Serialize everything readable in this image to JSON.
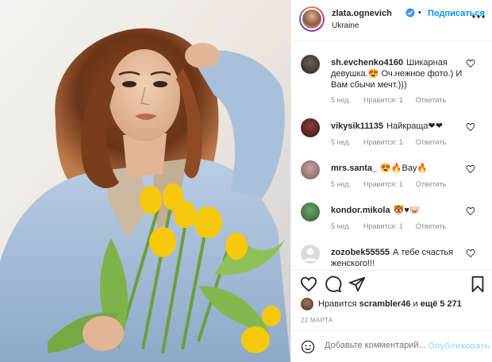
{
  "post": {
    "username": "zlata.ognevich",
    "separator": "•",
    "follow_label": "Подписаться",
    "location": "Ukraine",
    "accent": "#0095f6"
  },
  "comments": [
    {
      "user": "sh.evchenko4160",
      "text": "Шикарная девушка.😍 Оч.нежное фото.) И Вам сбычи мечт.)))",
      "time": "5 нед.",
      "likes": "Нравится: 1",
      "reply": "Ответить",
      "avatar_color": "#3a3530"
    },
    {
      "user": "vikysik11135",
      "text": "Найкраща❤❤",
      "time": "5 нед.",
      "likes": "Нравится: 1",
      "reply": "Ответить",
      "avatar_color": "#5a2a2a"
    },
    {
      "user": "mrs.santa_",
      "text": "😍🔥Вау🔥",
      "time": "5 нед.",
      "likes": "Нравится: 1",
      "reply": "Ответить",
      "avatar_color": "#b08a8a"
    },
    {
      "user": "kondor.mikola",
      "text": "🐯♥🐷",
      "time": "5 нед.",
      "likes": "Нравится: 1",
      "reply": "Ответить",
      "avatar_color": "#4a7a4a"
    },
    {
      "user": "zozobek55555",
      "text": "А тебе счастья женского!!!",
      "time": "",
      "likes": "",
      "reply": "",
      "avatar_color": "#dbdbdb"
    }
  ],
  "actions": {
    "like_icon": "heart-icon",
    "comment_icon": "comment-icon",
    "share_icon": "send-icon",
    "save_icon": "bookmark-icon"
  },
  "likes": {
    "prefix": "Нравится",
    "user": "scrambler46",
    "middle": "и",
    "count": "ещё 5 271"
  },
  "date": "22 МАРТА",
  "add_comment": {
    "placeholder": "Добавьте комментарий...",
    "post_label": "Опубликовать"
  }
}
